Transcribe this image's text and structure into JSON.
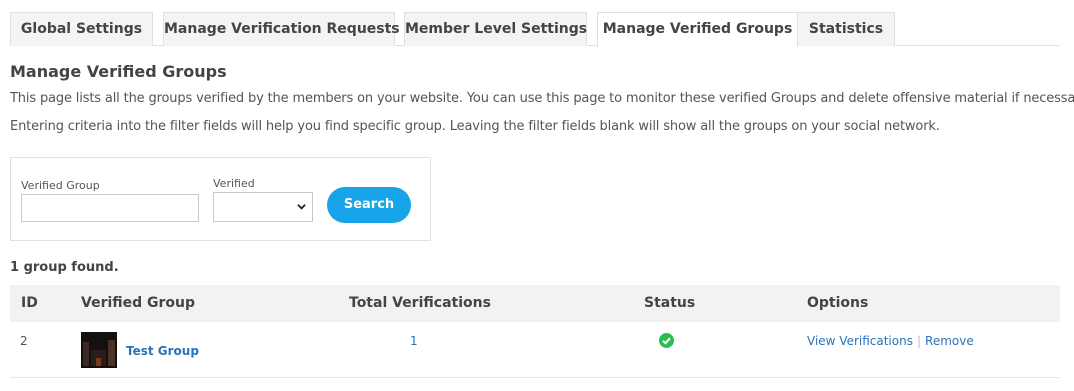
{
  "tabs": [
    {
      "label": "Global Settings",
      "active": false
    },
    {
      "label": "Manage Verification Requests",
      "active": false
    },
    {
      "label": "Member Level Settings",
      "active": false
    },
    {
      "label": "Manage Verified Groups",
      "active": true
    },
    {
      "label": "Statistics",
      "active": false
    }
  ],
  "page": {
    "title": "Manage Verified Groups",
    "description": "This page lists all the groups verified by the members on your website. You can use this page to monitor these verified Groups and delete offensive material if necessary.",
    "filter_help": "Entering criteria into the filter fields will help you find specific group. Leaving the filter fields blank will show all the groups on your social network."
  },
  "filter": {
    "group_label": "Verified Group",
    "group_value": "",
    "verified_label": "Verified",
    "verified_value": "",
    "search_label": "Search"
  },
  "results": {
    "count_text": "1 group found.",
    "columns": [
      "ID",
      "Verified Group",
      "Total Verifications",
      "Status",
      "Options"
    ],
    "rows": [
      {
        "id": "2",
        "group": "Test Group",
        "total_verifications": "1",
        "status": "verified",
        "options": [
          "View Verifications",
          "Remove"
        ]
      }
    ]
  },
  "colors": {
    "accent": "#18a4e8",
    "link": "#2a73b9",
    "status_ok": "#2bbd50"
  }
}
